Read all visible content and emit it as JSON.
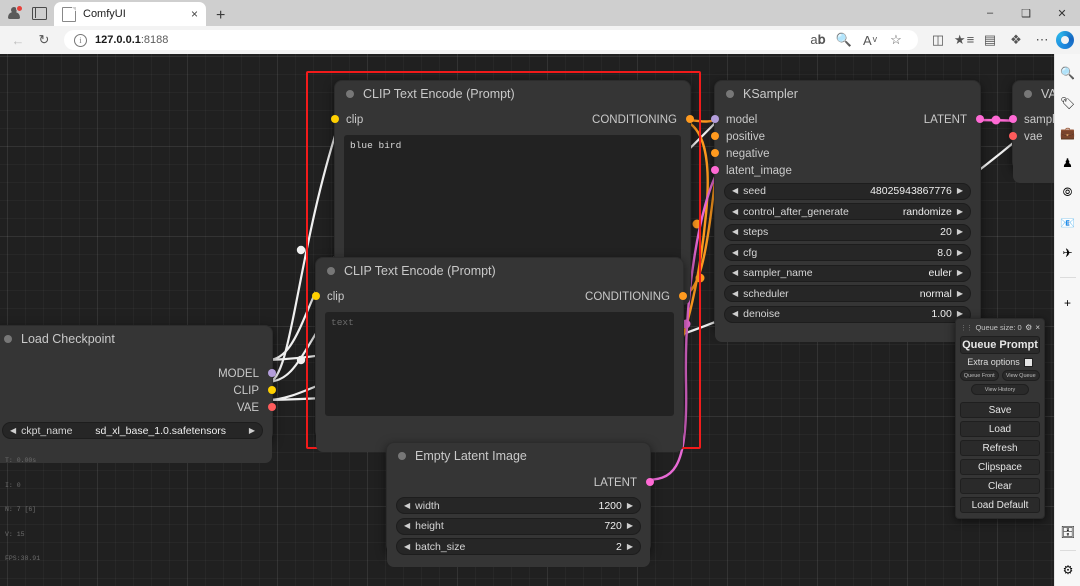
{
  "browser": {
    "tab": {
      "title": "ComfyUI",
      "close": "×"
    },
    "new_tab": "+",
    "window_controls": {
      "minimize": "–",
      "maximize": "❑",
      "close": "✕"
    },
    "nav": {
      "back": "←",
      "reload": "↻"
    },
    "address": {
      "protocol_info": "i",
      "host": "127.0.0.1",
      "port": ":8188"
    },
    "omni_icons": [
      "read-aloud-icon",
      "zoom-icon",
      "immersive-reader-icon",
      "favorite-star-icon"
    ],
    "toolbar_icons": [
      "split-screen-icon",
      "collections-icon",
      "browser-essentials-icon",
      "extensions-icon",
      "settings-more-icon"
    ],
    "sidebar_icons": [
      "search-icon",
      "shopping-tag-icon",
      "tools-icon",
      "games-icon",
      "copilot-icon",
      "outlook-icon",
      "telegram-icon",
      "add-sidebar-icon"
    ],
    "sidebar_bottom_icons": [
      "notes-icon",
      "sidebar-settings-icon"
    ]
  },
  "nodes": {
    "clip_positive": {
      "title": "CLIP Text Encode (Prompt)",
      "input": {
        "name": "clip",
        "color": "#ffd000"
      },
      "output": {
        "name": "CONDITIONING",
        "color": "#ff9a1f"
      },
      "text": "blue bird",
      "is_placeholder": false
    },
    "clip_negative": {
      "title": "CLIP Text Encode (Prompt)",
      "input": {
        "name": "clip",
        "color": "#ffd000"
      },
      "output": {
        "name": "CONDITIONING",
        "color": "#ff9a1f"
      },
      "text": "text",
      "is_placeholder": true
    },
    "ksampler": {
      "title": "KSampler",
      "inputs": [
        {
          "name": "model",
          "color": "#b39ddb"
        },
        {
          "name": "positive",
          "color": "#ff9a1f"
        },
        {
          "name": "negative",
          "color": "#ff9a1f"
        },
        {
          "name": "latent_image",
          "color": "#ff6ad5"
        }
      ],
      "outputs": [
        {
          "name": "LATENT",
          "color": "#ff6ad5"
        }
      ],
      "widgets": [
        {
          "name": "seed",
          "value": "48025943867776"
        },
        {
          "name": "control_after_generate",
          "value": "randomize"
        },
        {
          "name": "steps",
          "value": "20"
        },
        {
          "name": "cfg",
          "value": "8.0"
        },
        {
          "name": "sampler_name",
          "value": "euler"
        },
        {
          "name": "scheduler",
          "value": "normal"
        },
        {
          "name": "denoise",
          "value": "1.00"
        }
      ]
    },
    "load_checkpoint": {
      "title": "Load Checkpoint",
      "outputs": [
        {
          "name": "MODEL",
          "color": "#b39ddb"
        },
        {
          "name": "CLIP",
          "color": "#ffd000"
        },
        {
          "name": "VAE",
          "color": "#ff5c5c"
        }
      ],
      "widgets": [
        {
          "name": "ckpt_name",
          "value": "sd_xl_base_1.0.safetensors"
        }
      ]
    },
    "empty_latent": {
      "title": "Empty Latent Image",
      "outputs": [
        {
          "name": "LATENT",
          "color": "#ff6ad5"
        }
      ],
      "widgets": [
        {
          "name": "width",
          "value": "1200"
        },
        {
          "name": "height",
          "value": "720"
        },
        {
          "name": "batch_size",
          "value": "2"
        }
      ]
    },
    "vae_decode": {
      "title": "VAE",
      "inputs": [
        {
          "name": "sampl",
          "color": "#ff6ad5"
        },
        {
          "name": "vae",
          "color": "#ff5c5c"
        }
      ]
    }
  },
  "menu": {
    "queue_size_label": "Queue size: 0",
    "gear": "⚙",
    "close": "×",
    "queue_prompt": "Queue Prompt",
    "extra_options": "Extra options",
    "queue_front": "Queue Front",
    "view_queue": "View Queue",
    "view_history": "View History",
    "buttons": [
      "Save",
      "Load",
      "Refresh",
      "Clipspace",
      "Clear",
      "Load Default"
    ]
  },
  "stats": {
    "lines": [
      "T: 0.00s",
      "I: 0",
      "N: 7 [6]",
      "V: 15",
      "FPS:38.91"
    ]
  },
  "colors": {
    "selection": "#f21b1b",
    "canvas": "#202020",
    "node": "#353535"
  }
}
